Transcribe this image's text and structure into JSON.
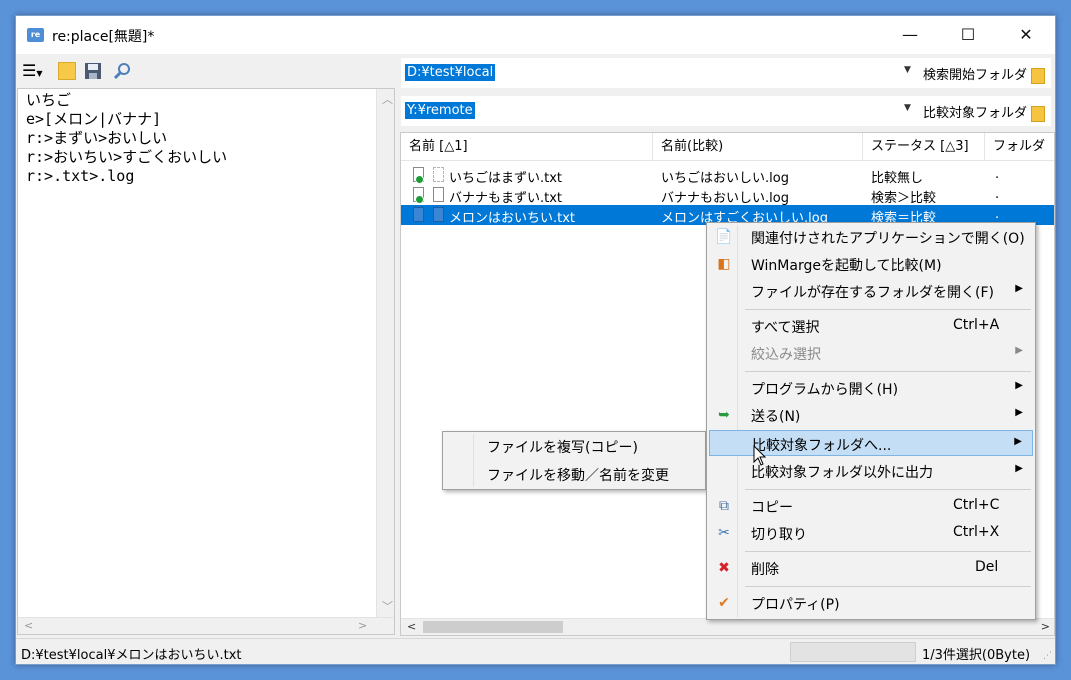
{
  "window": {
    "title": "re:place[無題]*",
    "app_icon_text": "re",
    "minimize_glyph": "—",
    "maximize_glyph": "☐",
    "close_glyph": "✕"
  },
  "toolbar": {
    "menu_icon": "hamburger-icon",
    "new_icon": "new-file-icon",
    "save_icon": "save-icon",
    "search_icon": "search-icon"
  },
  "editor": {
    "lines": "いちご\ne>[メロン|バナナ]\nr:>まずい>おいしい\nr:>おいちい>すごくおいしい\nr:>.txt>.log"
  },
  "search_folder": {
    "value": "D:¥test¥local",
    "button": "検索開始フォルダ"
  },
  "compare_folder": {
    "value": "Y:¥remote",
    "button": "比較対象フォルダ"
  },
  "file_list": {
    "columns": [
      "名前 [△1]",
      "名前(比較)",
      "ステータス [△3]",
      "フォルダ"
    ],
    "rows": [
      {
        "name": "いちごはまずい.txt",
        "compare": "いちごはおいしい.log",
        "status": "比較無し",
        "folder": "."
      },
      {
        "name": "バナナもまずい.txt",
        "compare": "バナナもおいしい.log",
        "status": "検索＞比較",
        "folder": "."
      },
      {
        "name": "メロンはおいちい.txt",
        "compare": "メロンはすごくおいしい.log",
        "status": "検索＝比較",
        "folder": "."
      }
    ]
  },
  "context_menu": {
    "open_with_app": "関連付けされたアプリケーションで開く(O)",
    "winmerge": "WinMargeを起動して比較(M)",
    "open_folder": "ファイルが存在するフォルダを開く(F)",
    "select_all": "すべて選択",
    "select_all_sc": "Ctrl+A",
    "filter_select": "絞込み選択",
    "open_with_program": "プログラムから開く(H)",
    "send_to": "送る(N)",
    "to_compare_folder": "比較対象フォルダへ...",
    "output_other": "比較対象フォルダ以外に出力",
    "copy": "コピー",
    "copy_sc": "Ctrl+C",
    "cut": "切り取り",
    "cut_sc": "Ctrl+X",
    "delete": "削除",
    "delete_sc": "Del",
    "properties": "プロパティ(P)"
  },
  "submenu": {
    "copy_file": "ファイルを複写(コピー)",
    "move_file": "ファイルを移動／名前を変更"
  },
  "statusbar": {
    "path": "D:¥test¥local¥メロンはおいちい.txt",
    "selection": "1/3件選択(0Byte)"
  },
  "colors": {
    "selection": "#0078d7",
    "menu_highlight": "#c3def5",
    "desktop": "#5b93d9"
  }
}
